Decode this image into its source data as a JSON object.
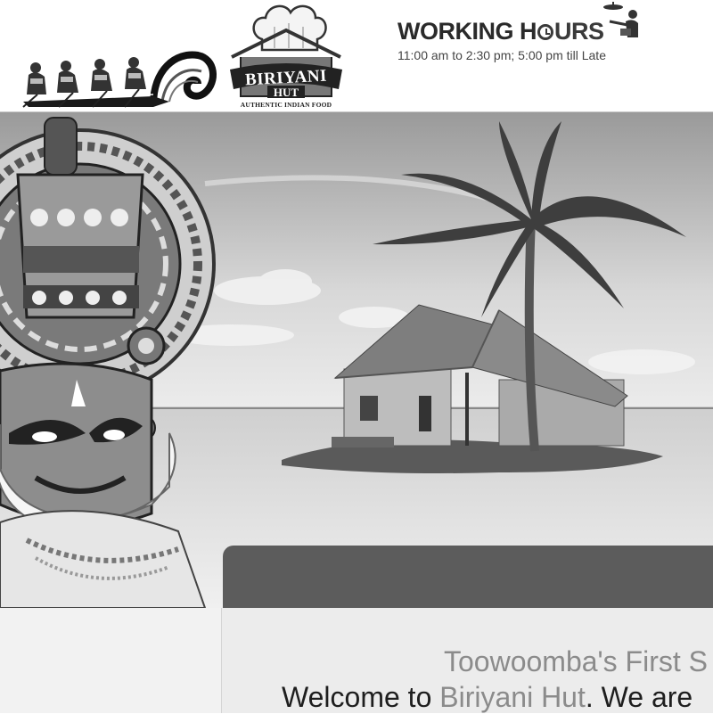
{
  "header": {
    "boat_logo_alt": "snake boat race",
    "brand": {
      "name_line1": "BIRIYANI",
      "name_line2": "HUT",
      "tagline": "AUTHENTIC INDIAN FOOD"
    },
    "hours": {
      "title_prefix": "WORKING H",
      "title_suffix": "URS",
      "text": "11:00 am to 2:30 pm; 5:00 pm till Late",
      "icon": "waiter-serving-icon"
    }
  },
  "hero": {
    "left_art": "kathakali-face",
    "scene": "thatched-hut-on-island-with-palm-tree"
  },
  "content": {
    "tagline": "Toowoomba's First S",
    "welcome_prefix": "Welcome to ",
    "welcome_brand": "Biriyani Hut",
    "welcome_suffix": ". We are"
  },
  "colors": {
    "band": "#5c5c5c",
    "muted_text": "#8b8b8b",
    "dark_text": "#1e1e1e"
  }
}
